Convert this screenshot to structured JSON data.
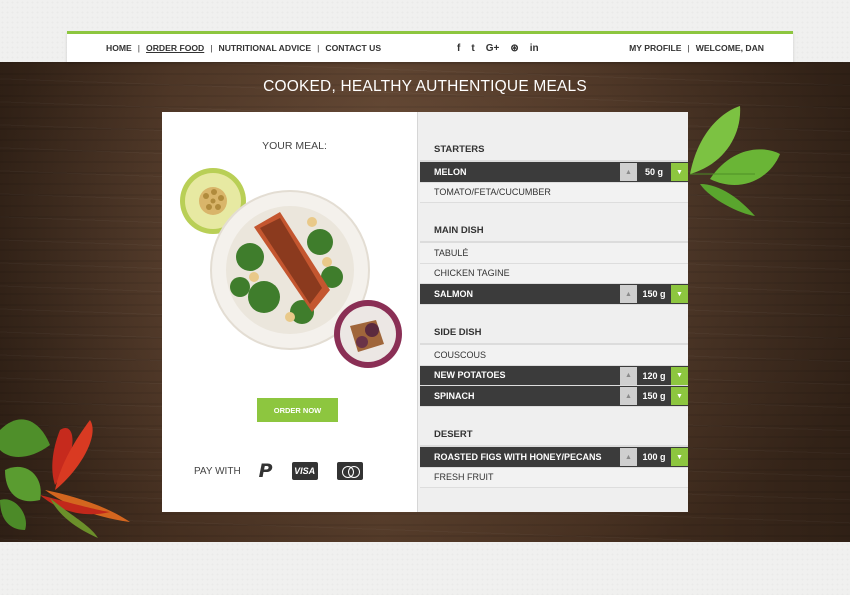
{
  "nav": {
    "links": [
      {
        "label": "HOME"
      },
      {
        "label": "ORDER FOOD",
        "active": true
      },
      {
        "label": "NUTRITIONAL ADVICE"
      },
      {
        "label": "CONTACT US"
      }
    ],
    "social": [
      "facebook-icon",
      "twitter-icon",
      "google-plus-icon",
      "dribbble-icon",
      "linkedin-icon"
    ],
    "social_glyphs": [
      "f",
      "t",
      "G+",
      "⊛",
      "in"
    ],
    "profile": "MY PROFILE",
    "welcome": "WELCOME, DAN",
    "separator": "|"
  },
  "heading": "COOKED, HEALTHY AUTHENTIQUE MEALS",
  "meal": {
    "label": "YOUR MEAL:",
    "order_button": "ORDER NOW",
    "pay_label": "PAY WITH",
    "pay_methods": [
      "paypal-icon",
      "visa-icon",
      "mastercard-icon"
    ],
    "paypal_glyph": "P",
    "visa_text": "VISA"
  },
  "menu": {
    "sections": [
      {
        "title": "STARTERS",
        "items": [
          {
            "label": "MELON",
            "selected": true,
            "qty": "50 g"
          },
          {
            "label": "TOMATO/FETA/CUCUMBER"
          }
        ]
      },
      {
        "title": "MAIN DISH",
        "items": [
          {
            "label": "TABULÉ"
          },
          {
            "label": "CHICKEN TAGINE"
          },
          {
            "label": "SALMON",
            "selected": true,
            "qty": "150 g"
          }
        ]
      },
      {
        "title": "SIDE DISH",
        "items": [
          {
            "label": "COUSCOUS"
          },
          {
            "label": "NEW POTATOES",
            "selected": true,
            "qty": "120 g"
          },
          {
            "label": "SPINACH",
            "selected": true,
            "qty": "150 g"
          }
        ]
      },
      {
        "title": "DESERT",
        "items": [
          {
            "label": "ROASTED FIGS WITH HONEY/PECANS",
            "selected": true,
            "qty": "100 g"
          },
          {
            "label": "FRESH FRUIT"
          }
        ]
      }
    ]
  },
  "colors": {
    "accent": "#8dc63f",
    "dark": "#3b3b3b"
  }
}
